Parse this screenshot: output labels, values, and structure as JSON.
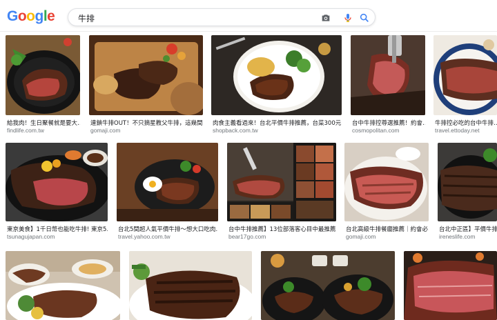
{
  "search": {
    "query": "牛排"
  },
  "logo": {
    "letters": [
      "G",
      "o",
      "o",
      "g",
      "l",
      "e"
    ],
    "colors": [
      "#4285F4",
      "#EA4335",
      "#FBBC05",
      "#4285F4",
      "#34A853",
      "#EA4335"
    ]
  },
  "icons": {
    "camera": "camera-icon",
    "mic": "microphone-icon",
    "search": "search-icon"
  },
  "results": [
    {
      "caption": "給我肉！生日聚餐就是要大…",
      "domain": "findlife.com.tw"
    },
    {
      "caption": "連鎖牛排OUT！不只摘星教父牛排，這幾間…",
      "domain": "gomaji.com"
    },
    {
      "caption": "肉食主義看過來！台北平價牛排推薦，台菜300元…",
      "domain": "shopback.com.tw"
    },
    {
      "caption": "台中牛排控尊選推薦！約會…",
      "domain": "cosmopolitan.com"
    },
    {
      "caption": "牛排控必吃的台中牛排…",
      "domain": "travel.ettoday.net"
    },
    {
      "caption": "東京美食】1千日幣也能吃牛排! 東京5…",
      "domain": "tsunagujapan.com"
    },
    {
      "caption": "台北5間超人氣平價牛排～想大口吃肉…",
      "domain": "travel.yahoo.com.tw"
    },
    {
      "caption": "台中牛排推薦】13位部落客心目中最推薦…",
      "domain": "bear17go.com"
    },
    {
      "caption": "台北高級牛排餐廳推薦｜約會必…",
      "domain": "gomaji.com"
    },
    {
      "caption": "台北中正區】平價牛排+…",
      "domain": "ireneslife.com"
    }
  ]
}
